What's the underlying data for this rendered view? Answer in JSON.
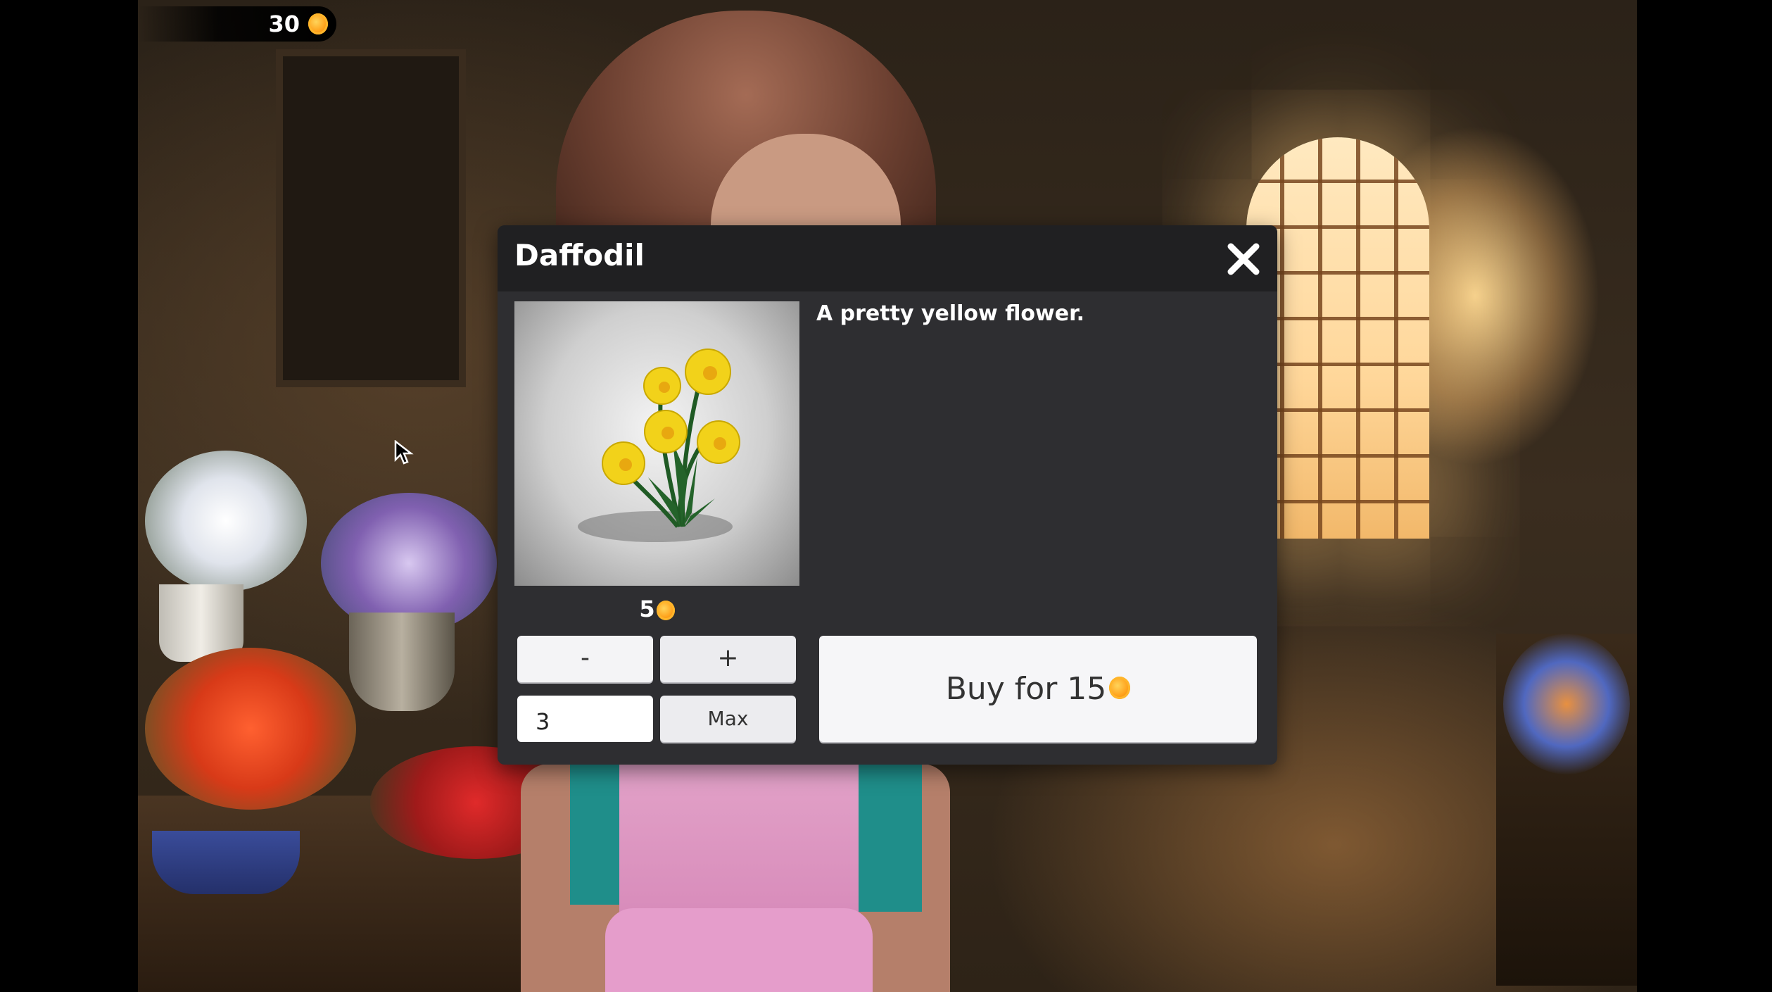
{
  "hud": {
    "currency_amount": "30",
    "currency_icon": "coin-icon"
  },
  "dialog": {
    "title": "Daffodil",
    "close_icon": "close-icon",
    "item_image_icon": "daffodil-flower-image",
    "description": "A pretty yellow flower.",
    "unit_price": "5",
    "minus_label": "-",
    "plus_label": "+",
    "quantity_value": "3",
    "max_label": "Max",
    "buy_label": "Buy for 15"
  },
  "colors": {
    "dialog_bg": "#2e2e31",
    "header_bg": "#202022",
    "button_bg": "#f4f4f6",
    "coin": "#ffa21c",
    "flower_yellow": "#f2d21a"
  }
}
